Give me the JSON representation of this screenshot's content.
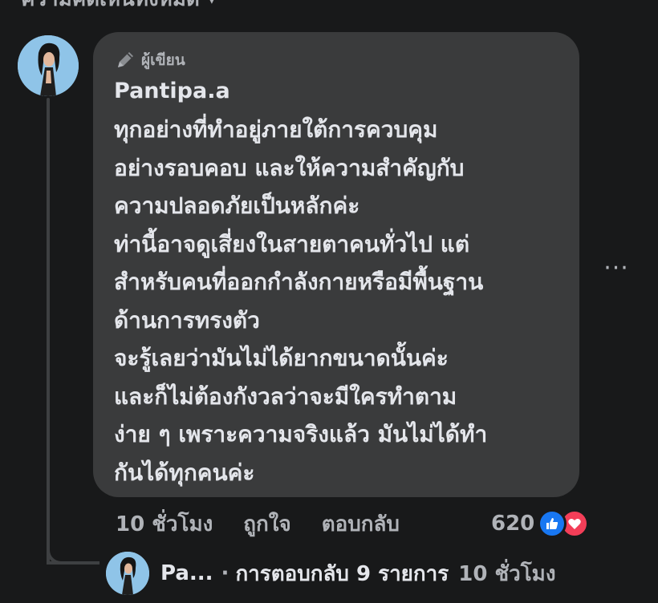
{
  "section": {
    "header_label": "ความคิดเห็นทั้งหมด",
    "header_chevron": "▾"
  },
  "comment": {
    "author_badge": "ผู้เขียน",
    "author_name": "Pantipa.a",
    "lines": [
      "ทุกอย่างที่ทำอยู่ภายใต้การควบคุม",
      "อย่างรอบคอบ และให้ความสำคัญกับ",
      "ความปลอดภัยเป็นหลักค่ะ",
      "ท่านี้อาจดูเสี่ยงในสายตาคนทั่วไป แต่",
      "สำหรับคนที่ออกกำลังกายหรือมีพื้นฐาน",
      "ด้านการทรงตัว",
      "จะรู้เลยว่ามันไม่ได้ยากขนาดนั้นค่ะ",
      "และก็ไม่ต้องกังวลว่าจะมีใครทำตาม",
      "ง่าย ๆ เพราะความจริงแล้ว มันไม่ได้ทำ",
      "กันได้ทุกคนค่ะ"
    ],
    "more_label": "···",
    "time": "10 ชั่วโมง",
    "like_label": "ถูกใจ",
    "reply_label": "ตอบกลับ",
    "reaction_count": "620",
    "colors": {
      "like": "#1877f2",
      "love": "#f33e58",
      "bubble": "#3a3b3c",
      "background": "#18191a"
    }
  },
  "reply_summary": {
    "name": "Pa...",
    "separator": "·",
    "count_label": "การตอบกลับ 9 รายการ",
    "time": "10 ชั่วโมง"
  },
  "icons": {
    "author_badge": "pencil-icon",
    "like_reaction": "thumbs-up-icon",
    "love_reaction": "heart-icon",
    "more": "more-options-icon"
  }
}
